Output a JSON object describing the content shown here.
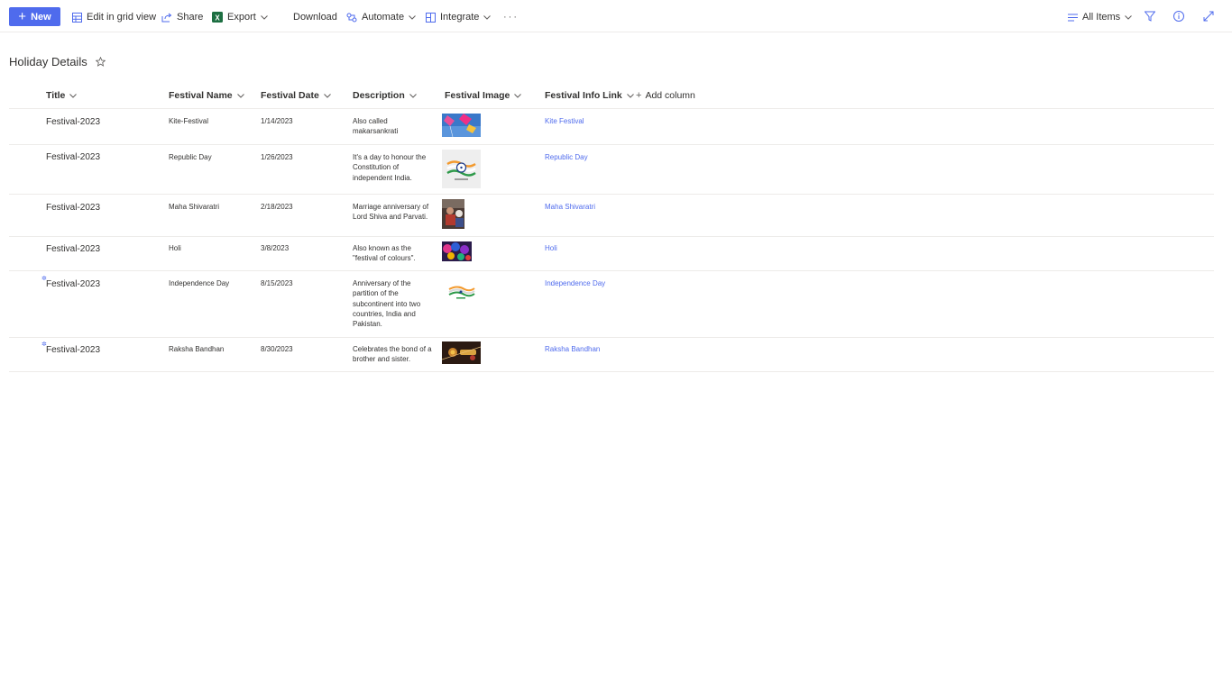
{
  "toolbar": {
    "new_label": "New",
    "edit_grid_label": "Edit in grid view",
    "share_label": "Share",
    "export_label": "Export",
    "download_label": "Download",
    "automate_label": "Automate",
    "integrate_label": "Integrate",
    "more_label": "···",
    "view_label": "All Items"
  },
  "list": {
    "title": "Holiday Details",
    "columns": {
      "title": "Title",
      "festival_name": "Festival Name",
      "festival_date": "Festival Date",
      "description": "Description",
      "festival_image": "Festival Image",
      "festival_info_link": "Festival Info Link",
      "add_column": "Add column"
    },
    "rows": [
      {
        "title": "Festival-2023",
        "name": "Kite-Festival",
        "date": "1/14/2023",
        "desc": "Also called makarsankrati",
        "link": "Kite Festival",
        "image": "kite festival photo"
      },
      {
        "title": "Festival-2023",
        "name": "Republic Day",
        "date": "1/26/2023",
        "desc": "It's a day to honour the Constitution of independent India.",
        "link": "Republic Day",
        "image": "republic day emblem"
      },
      {
        "title": "Festival-2023",
        "name": "Maha Shivaratri",
        "date": "2/18/2023",
        "desc": "Marriage anniversary of Lord Shiva and Parvati.",
        "link": "Maha Shivaratri",
        "image": "shivaratri photo"
      },
      {
        "title": "Festival-2023",
        "name": "Holi",
        "date": "3/8/2023",
        "desc": "Also known as the \"festival of colours\".",
        "link": "Holi",
        "image": "holi colours photo"
      },
      {
        "title": "Festival-2023",
        "name": "Independence Day",
        "date": "8/15/2023",
        "desc": "Anniversary of the partition of the subcontinent into two countries, India and Pakistan.",
        "link": "Independence Day",
        "image": "independence day flag"
      },
      {
        "title": "Festival-2023",
        "name": "Raksha Bandhan",
        "date": "8/30/2023",
        "desc": "Celebrates the bond of a brother and sister.",
        "link": "Raksha Bandhan",
        "image": "rakhi photo"
      }
    ]
  },
  "colors": {
    "accent": "#4f6bed",
    "text": "#323130",
    "divider": "#edebe9"
  }
}
